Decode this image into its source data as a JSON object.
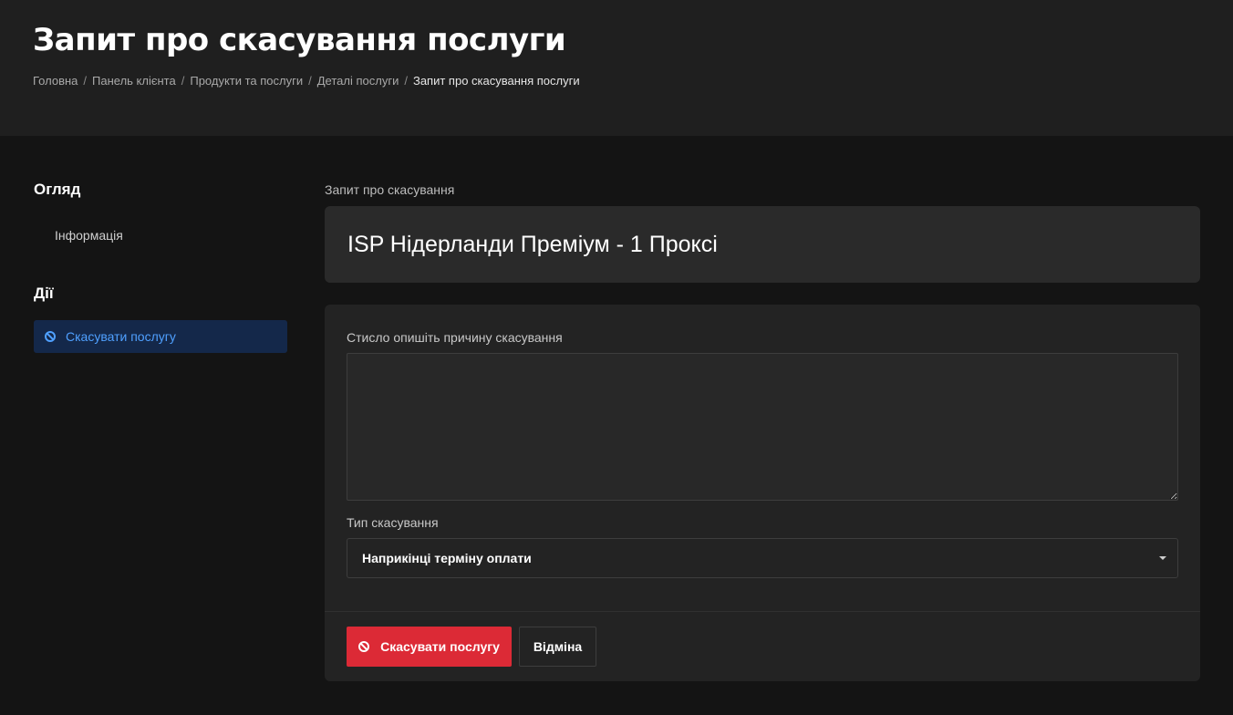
{
  "header": {
    "title": "Запит про скасування послуги",
    "breadcrumb": [
      "Головна",
      "Панель клієнта",
      "Продукти та послуги",
      "Деталі послуги"
    ],
    "breadcrumb_active": "Запит про скасування послуги"
  },
  "sidebar": {
    "overview_heading": "Огляд",
    "overview_items": [
      {
        "label": "Інформація",
        "icon": "dashboard-icon"
      }
    ],
    "actions_heading": "Дії",
    "action_items": [
      {
        "label": "Скасувати послугу",
        "icon": "ban-icon",
        "active": true
      }
    ]
  },
  "main": {
    "section_label": "Запит про скасування",
    "product_name": "ISP Нідерланди Преміум - 1 Проксі",
    "reason_label": "Стисло опишіть причину скасування",
    "reason_value": "",
    "type_label": "Тип скасування",
    "type_selected": "Наприкінці терміну оплати",
    "submit_label": "Скасувати послугу",
    "cancel_label": "Відміна"
  },
  "colors": {
    "accent": "#4fa0ff",
    "danger": "#dc2a36",
    "active_bg": "#14284a",
    "background": "#141414",
    "header_bg": "#1f1f1f"
  }
}
